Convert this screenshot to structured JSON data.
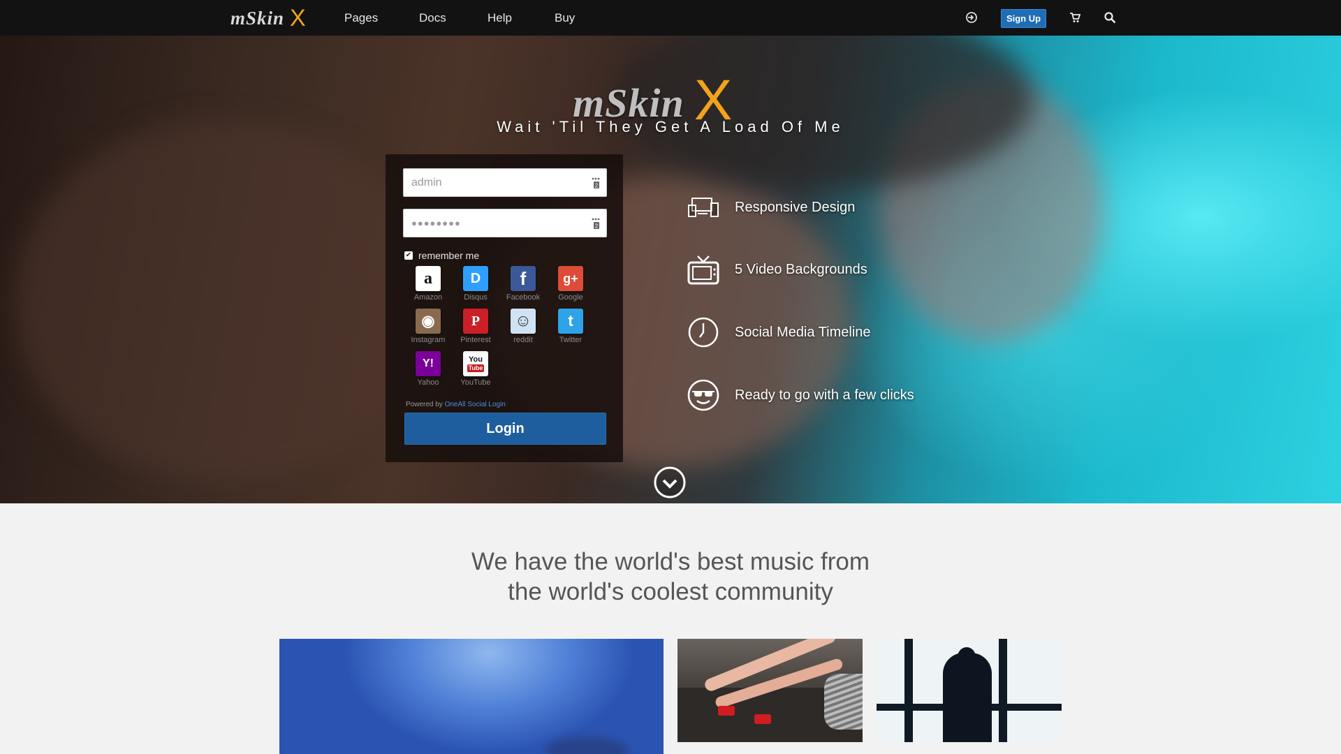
{
  "nav": {
    "logo_text": "mSkin",
    "logo_accent": "X",
    "links": [
      "Pages",
      "Docs",
      "Help",
      "Buy"
    ],
    "signup_label": "Sign Up"
  },
  "hero": {
    "logo_text": "mSkin",
    "logo_accent": "X",
    "tagline": "Wait 'Til They Get A Load Of Me"
  },
  "login": {
    "username_value": "admin",
    "password_value": "●●●●●●●●",
    "remember_label": "remember me",
    "remember_checked": true,
    "social": [
      {
        "name": "Amazon",
        "icon": "amazon-icon",
        "glyph": "a",
        "color": "#ffffff"
      },
      {
        "name": "Disqus",
        "icon": "disqus-icon",
        "glyph": "D",
        "color": "#2e9fff"
      },
      {
        "name": "Facebook",
        "icon": "facebook-icon",
        "glyph": "f",
        "color": "#3b5998"
      },
      {
        "name": "Google",
        "icon": "google-icon",
        "glyph": "g+",
        "color": "#dd4b39"
      },
      {
        "name": "Instagram",
        "icon": "instagram-icon",
        "glyph": "◉",
        "color": "#8a6a4f"
      },
      {
        "name": "Pinterest",
        "icon": "pinterest-icon",
        "glyph": "P",
        "color": "#cb2027"
      },
      {
        "name": "reddit",
        "icon": "reddit-icon",
        "glyph": "☺",
        "color": "#cfe3f5"
      },
      {
        "name": "Twitter",
        "icon": "twitter-icon",
        "glyph": "t",
        "color": "#2ea3e8"
      },
      {
        "name": "Yahoo",
        "icon": "yahoo-icon",
        "glyph": "Y!",
        "color": "#7b0099"
      },
      {
        "name": "YouTube",
        "icon": "youtube-icon",
        "glyph": "You",
        "color": "#ffffff"
      }
    ],
    "powered_prefix": "Powered by",
    "powered_link": "OneAll Social Login",
    "button_label": "Login"
  },
  "features": [
    {
      "label": "Responsive Design",
      "icon": "responsive-devices-icon"
    },
    {
      "label": "5 Video Backgrounds",
      "icon": "tv-icon"
    },
    {
      "label": "Social Media Timeline",
      "icon": "clock-icon"
    },
    {
      "label": "Ready to go with a few clicks",
      "icon": "sunglasses-smiley-icon"
    }
  ],
  "content": {
    "headline_line1": "We have the world's best music from",
    "headline_line2": "the world's coolest community"
  },
  "colors": {
    "accent": "#f2a31b",
    "primary_button": "#1f5e9e",
    "signup_button": "#1f6db5",
    "nav_bg": "#121212"
  }
}
